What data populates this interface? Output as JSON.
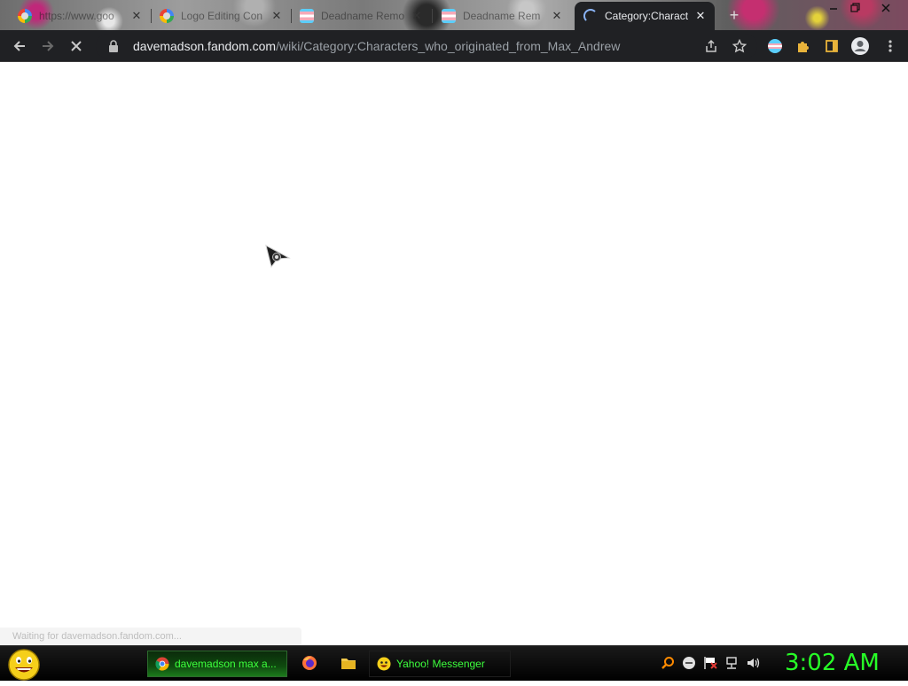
{
  "browser": {
    "tabs": [
      {
        "title": "https://www.goo",
        "favicon": "google-icon",
        "active": false
      },
      {
        "title": "Logo Editing Con",
        "favicon": "google-icon",
        "active": false
      },
      {
        "title": "Deadname Remo",
        "favicon": "trans-flag-icon",
        "active": false
      },
      {
        "title": "Deadname Rem",
        "favicon": "trans-flag-icon",
        "active": false
      },
      {
        "title": "Category:Charact",
        "favicon": "loading-spinner-icon",
        "active": true
      }
    ],
    "new_tab_label": "+",
    "address_bar": {
      "host": "davemadson.fandom.com",
      "path": "/wiki/Category:Characters_who_originated_from_Max_Andrew"
    },
    "toolbar_icons": [
      "back-icon",
      "forward-icon",
      "stop-loading-icon",
      "share-icon",
      "bookmark-star-icon",
      "extension-flag-icon",
      "puzzle-extensions-icon",
      "side-panel-icon",
      "profile-icon",
      "menu-icon"
    ]
  },
  "page": {
    "loading": true,
    "status_text": "Waiting for davemadson.fandom.com..."
  },
  "taskbar": {
    "tasks": [
      {
        "label": "davemadson max a...",
        "icon": "chrome-icon",
        "active": true
      },
      {
        "label": "Yahoo! Messenger",
        "icon": "yahoo-messenger-icon",
        "active": false
      }
    ],
    "quick_launch": [
      "firefox-icon",
      "folder-icon"
    ],
    "tray_icons": [
      "search-icon",
      "messenger-status-icon",
      "action-center-flag-icon",
      "network-icon",
      "volume-icon"
    ],
    "clock": "3:02 AM"
  },
  "colors": {
    "chrome_dark": "#202124",
    "taskbar_text": "#3cff3c",
    "clock": "#27ff27"
  }
}
